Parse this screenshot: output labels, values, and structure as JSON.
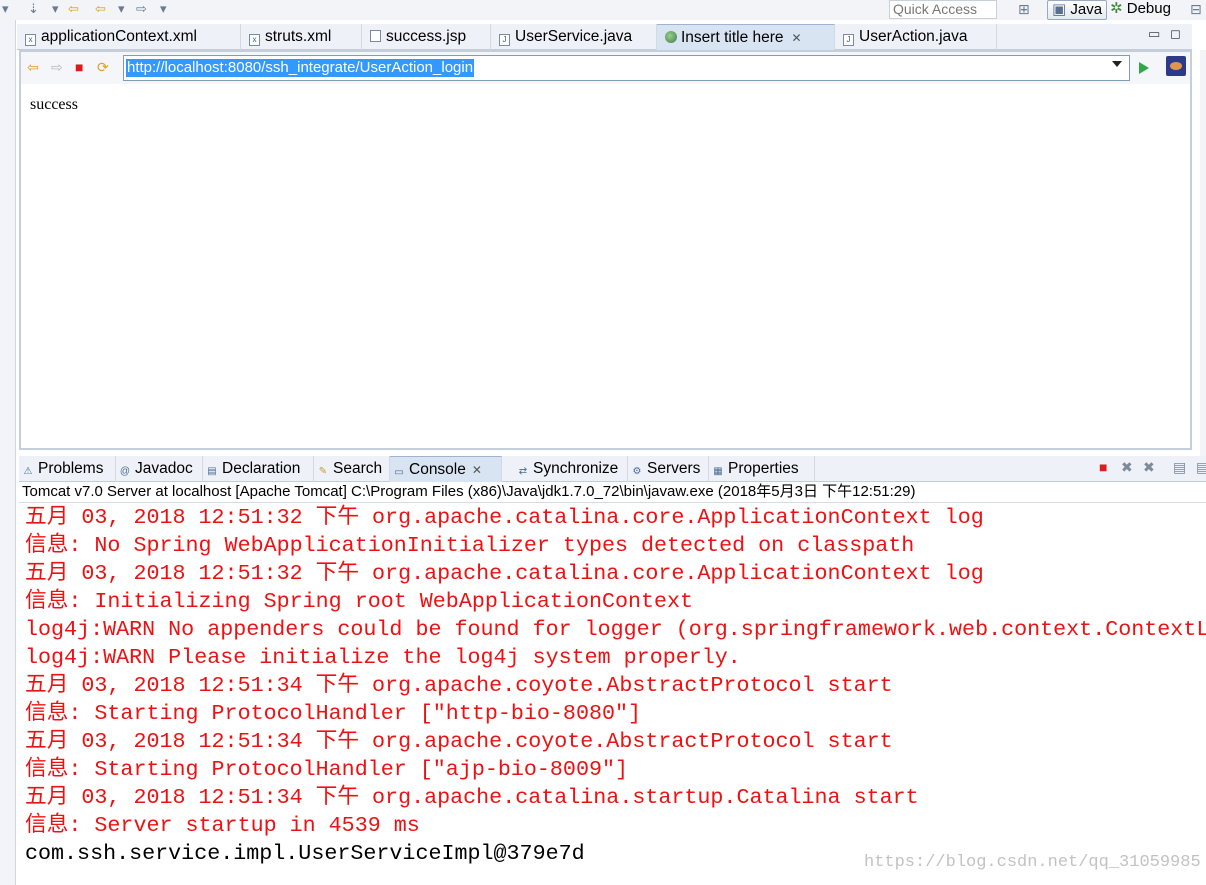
{
  "toolbar": {
    "quick_access": "Quick Access",
    "perspectives": {
      "java": "Java",
      "debug": "Debug"
    }
  },
  "editor_tabs": [
    {
      "label": "applicationContext.xml",
      "icon": "xml-file-icon"
    },
    {
      "label": "struts.xml",
      "icon": "xml-file-icon"
    },
    {
      "label": "success.jsp",
      "icon": "jsp-file-icon"
    },
    {
      "label": "UserService.java",
      "icon": "java-file-icon"
    },
    {
      "label": "Insert title here",
      "icon": "globe-icon",
      "active": true
    },
    {
      "label": "UserAction.java",
      "icon": "java-file-icon"
    }
  ],
  "browser": {
    "url": "http://localhost:8080/ssh_integrate/UserAction_login",
    "content": "success"
  },
  "views_tabs": [
    {
      "label": "Problems",
      "icon": "problems-icon"
    },
    {
      "label": "Javadoc",
      "icon": "javadoc-icon"
    },
    {
      "label": "Declaration",
      "icon": "declaration-icon"
    },
    {
      "label": "Search",
      "icon": "search-icon"
    },
    {
      "label": "Console",
      "icon": "console-icon",
      "active": true
    },
    {
      "label": "Synchronize",
      "icon": "synchronize-icon"
    },
    {
      "label": "Servers",
      "icon": "servers-icon"
    },
    {
      "label": "Properties",
      "icon": "properties-icon"
    }
  ],
  "console": {
    "header": "Tomcat v7.0 Server at localhost [Apache Tomcat] C:\\Program Files (x86)\\Java\\jdk1.7.0_72\\bin\\javaw.exe (2018年5月3日 下午12:51:29)",
    "lines": [
      {
        "text": "五月 03, 2018 12:51:32 下午 org.apache.catalina.core.ApplicationContext log",
        "color": "#ee1111"
      },
      {
        "text": "信息: No Spring WebApplicationInitializer types detected on classpath",
        "color": "#ee1111"
      },
      {
        "text": "五月 03, 2018 12:51:32 下午 org.apache.catalina.core.ApplicationContext log",
        "color": "#ee1111"
      },
      {
        "text": "信息: Initializing Spring root WebApplicationContext",
        "color": "#ee1111"
      },
      {
        "text": "log4j:WARN No appenders could be found for logger (org.springframework.web.context.ContextL",
        "color": "#ee1111"
      },
      {
        "text": "log4j:WARN Please initialize the log4j system properly.",
        "color": "#ee1111"
      },
      {
        "text": "五月 03, 2018 12:51:34 下午 org.apache.coyote.AbstractProtocol start",
        "color": "#ee1111"
      },
      {
        "text": "信息: Starting ProtocolHandler [\"http-bio-8080\"]",
        "color": "#ee1111"
      },
      {
        "text": "五月 03, 2018 12:51:34 下午 org.apache.coyote.AbstractProtocol start",
        "color": "#ee1111"
      },
      {
        "text": "信息: Starting ProtocolHandler [\"ajp-bio-8009\"]",
        "color": "#ee1111"
      },
      {
        "text": "五月 03, 2018 12:51:34 下午 org.apache.catalina.startup.Catalina start",
        "color": "#ee1111"
      },
      {
        "text": "信息: Server startup in 4539 ms",
        "color": "#ee1111"
      },
      {
        "text": "com.ssh.service.impl.UserServiceImpl@379e7d",
        "color": "#000000"
      }
    ]
  },
  "watermark": "https://blog.csdn.net/qq_31059985"
}
